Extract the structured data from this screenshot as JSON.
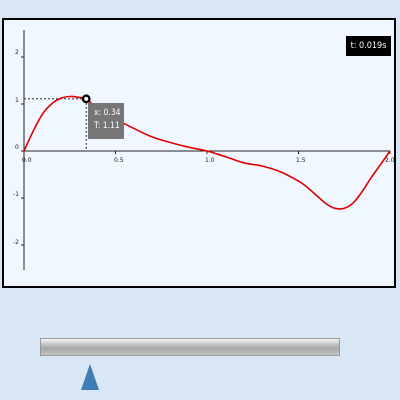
{
  "readout": {
    "time": "t: 0.019s"
  },
  "tooltip": {
    "x_text": "x: 0.34",
    "t_text": "T: 1.11"
  },
  "axes": {
    "x_ticks": [
      "0.0",
      "0.5",
      "1.0",
      "1.5",
      "2.0"
    ],
    "y_ticks": [
      "2",
      "1",
      "0",
      "-1",
      "-2"
    ]
  },
  "colors": {
    "curve": "#e00000",
    "panel_background": "#f0f7ff",
    "page_background": "#d8e6f6",
    "slider_handle": "#3d7db3",
    "tooltip_background": "#767676"
  },
  "slider": {
    "position": 0.17
  },
  "chart_data": {
    "type": "line",
    "xlim": [
      0,
      2
    ],
    "ylim": [
      -2.5,
      2.5
    ],
    "series": [
      {
        "x": [
          0,
          0.05,
          0.1,
          0.15,
          0.2,
          0.25,
          0.3,
          0.34,
          0.4,
          0.45,
          0.5,
          0.6,
          0.7,
          0.8,
          0.9,
          1.0,
          1.1,
          1.2,
          1.3,
          1.4,
          1.5,
          1.55,
          1.6,
          1.65,
          1.7,
          1.75,
          1.8,
          1.85,
          1.9,
          1.95,
          2.0
        ],
        "y": [
          0,
          0.42,
          0.78,
          1.0,
          1.12,
          1.16,
          1.14,
          1.11,
          0.9,
          0.78,
          0.68,
          0.48,
          0.3,
          0.18,
          0.08,
          0.0,
          -0.12,
          -0.25,
          -0.32,
          -0.44,
          -0.64,
          -0.78,
          -0.95,
          -1.12,
          -1.22,
          -1.22,
          -1.1,
          -0.85,
          -0.55,
          -0.28,
          0.0
        ]
      }
    ],
    "marker": {
      "x": 0.34,
      "y": 1.11
    }
  }
}
